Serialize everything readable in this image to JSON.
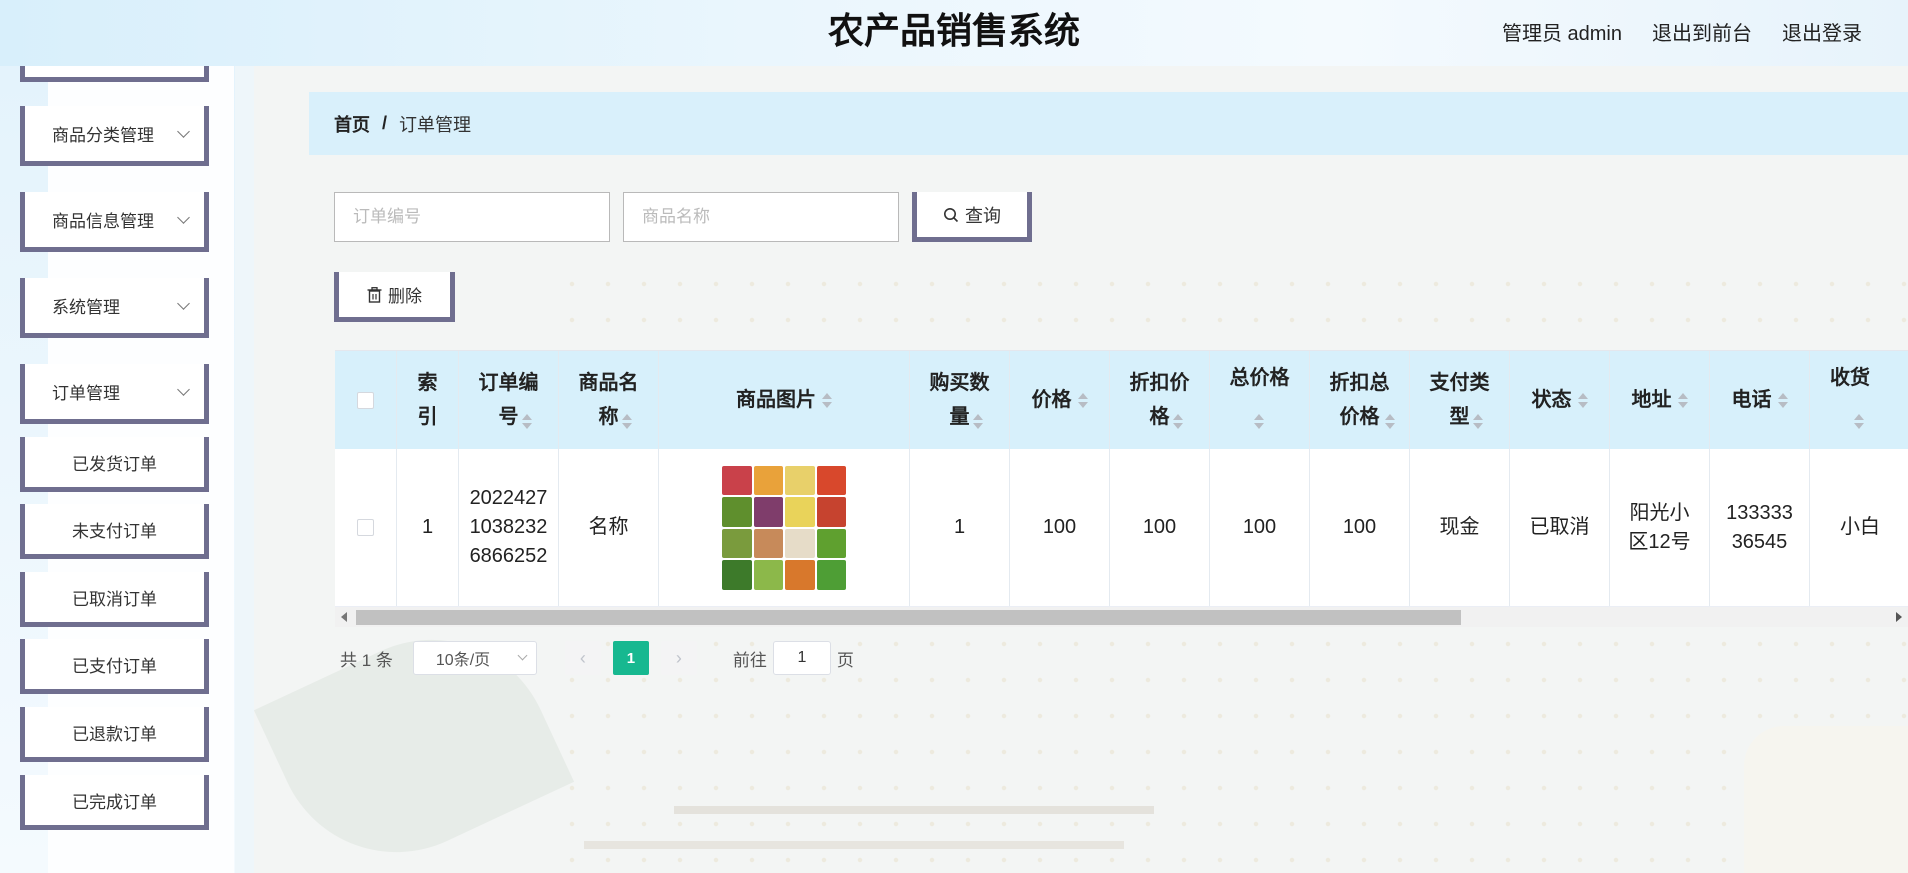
{
  "header": {
    "app_title": "农产品销售系统",
    "admin_label": "管理员 admin",
    "to_frontend": "退出到前台",
    "logout": "退出登录"
  },
  "sidebar": {
    "menus": [
      {
        "label": "商品分类管理",
        "icon": "chevron-down-icon"
      },
      {
        "label": "商品信息管理",
        "icon": "chevron-down-icon"
      },
      {
        "label": "系统管理",
        "icon": "chevron-down-icon"
      },
      {
        "label": "订单管理",
        "icon": "chevron-down-icon"
      }
    ],
    "order_submenu": [
      "已发货订单",
      "未支付订单",
      "已取消订单",
      "已支付订单",
      "已退款订单",
      "已完成订单"
    ]
  },
  "breadcrumb": {
    "home": "首页",
    "separator": "/",
    "current": "订单管理"
  },
  "search": {
    "order_no_placeholder": "订单编号",
    "product_name_placeholder": "商品名称",
    "query_label": "查询",
    "query_icon": "search-icon"
  },
  "toolbar": {
    "delete_label": "删除",
    "delete_icon": "trash-icon"
  },
  "table": {
    "columns": [
      "索引",
      "订单编号",
      "商品名称",
      "商品图片",
      "购买数量",
      "价格",
      "折扣价格",
      "总价格",
      "折扣总价格",
      "支付类型",
      "状态",
      "地址",
      "电话",
      "收货"
    ],
    "rows": [
      {
        "index": "1",
        "order_no": "202242710382326866252",
        "product_name": "名称",
        "quantity": "1",
        "price": "100",
        "discount_price": "100",
        "total_price": "100",
        "discount_total": "100",
        "pay_type": "现金",
        "status": "已取消",
        "address": "阳光小区12号",
        "phone": "13333336545",
        "receiver": "小白"
      }
    ]
  },
  "pagination": {
    "total": "共 1 条",
    "page_size": "10条/页",
    "current_page": "1",
    "goto_label": "前往",
    "goto_value": "1",
    "page_suffix": "页"
  },
  "colors": {
    "accent": "#17b890",
    "header_bg": "#d7f0fb",
    "border_accent": "#6f6e8f"
  }
}
